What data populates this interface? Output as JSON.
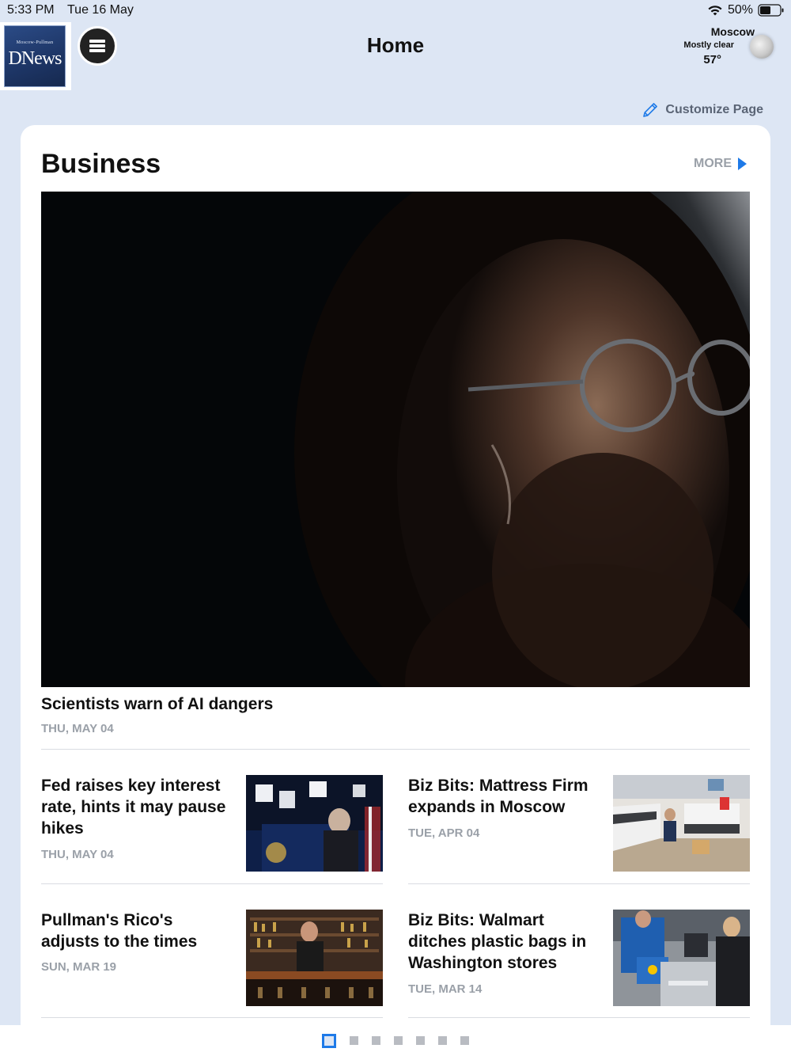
{
  "status_bar": {
    "time": "5:33 PM",
    "date": "Tue 16 May",
    "battery": "50%"
  },
  "header": {
    "logo_small_text": "Moscow-Pullman",
    "logo_big_text": "DNews",
    "title": "Home",
    "weather": {
      "city": "Moscow",
      "condition": "Mostly clear",
      "temperature": "57°",
      "icon": "moon-icon"
    }
  },
  "toolbar": {
    "customize_label": "Customize Page"
  },
  "section": {
    "title": "Business",
    "more_label": "MORE",
    "hero": {
      "headline": "Scientists warn of AI dangers",
      "date": "THU, MAY 04"
    },
    "stories": [
      {
        "headline": "Fed raises key interest rate, hints it may pause hikes",
        "date": "THU, MAY 04"
      },
      {
        "headline": "Biz Bits: Mattress Firm expands in Moscow",
        "date": "TUE, APR 04"
      },
      {
        "headline": "Pullman's Rico's adjusts to the times",
        "date": "SUN, MAR 19"
      },
      {
        "headline": "Biz Bits: Walmart ditches plastic bags in Washington stores",
        "date": "TUE, MAR 14"
      }
    ]
  },
  "pager": {
    "current_page": 1,
    "total_pages": 7
  },
  "colors": {
    "accent": "#1e7ae8",
    "header_bg": "#dde6f4",
    "muted_text": "#9aa0a8"
  }
}
